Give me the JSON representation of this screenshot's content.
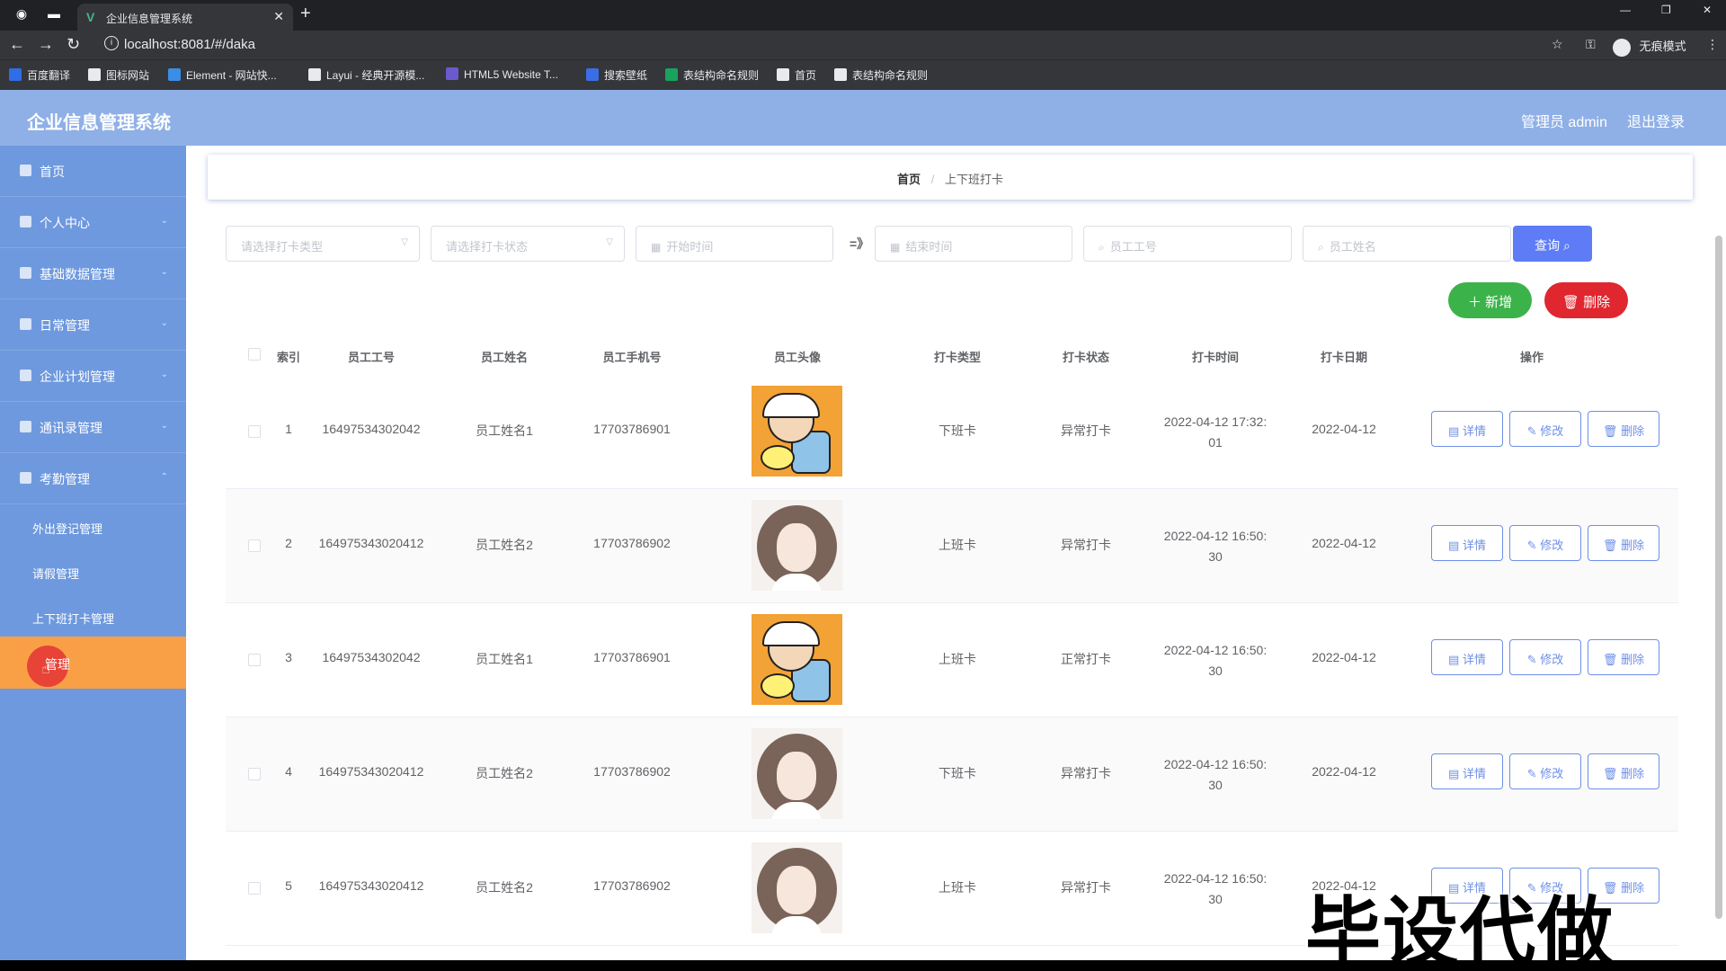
{
  "browser": {
    "tab_title": "企业信息管理系统",
    "url": "localhost:8081/#/daka",
    "incognito_label": "无痕模式",
    "bookmarks": [
      {
        "label": "百度翻译",
        "color": "#2f6ee6"
      },
      {
        "label": "图标网站",
        "color": "#e8eaed"
      },
      {
        "label": "Element - 网站快...",
        "color": "#3b8ee6"
      },
      {
        "label": "Layui - 经典开源模...",
        "color": "#e8eaed"
      },
      {
        "label": "HTML5 Website T...",
        "color": "#6a5acd"
      },
      {
        "label": "搜索壁纸",
        "color": "#3b6ee6"
      },
      {
        "label": "表结构命名规则",
        "color": "#1aa260"
      },
      {
        "label": "首页",
        "color": "#e8eaed"
      },
      {
        "label": "表结构命名规则",
        "color": "#e8eaed"
      }
    ]
  },
  "app": {
    "title": "企业信息管理系统",
    "user": "管理员 admin",
    "logout": "退出登录"
  },
  "sidebar": {
    "items": [
      {
        "label": "首页"
      },
      {
        "label": "个人中心"
      },
      {
        "label": "基础数据管理"
      },
      {
        "label": "日常管理"
      },
      {
        "label": "企业计划管理"
      },
      {
        "label": "通讯录管理"
      },
      {
        "label": "考勤管理"
      }
    ],
    "sub_items": [
      {
        "label": "外出登记管理"
      },
      {
        "label": "请假管理"
      },
      {
        "label": "上下班打卡管理"
      }
    ],
    "active_label": "管理"
  },
  "breadcrumb": {
    "home": "首页",
    "separator": "/",
    "current": "上下班打卡"
  },
  "search": {
    "type_placeholder": "请选择打卡类型",
    "status_placeholder": "请选择打卡状态",
    "start_placeholder": "开始时间",
    "range_separator": "=》",
    "end_placeholder": "结束时间",
    "emp_no_placeholder": "员工工号",
    "emp_name_placeholder": "员工姓名",
    "query_label": "查询"
  },
  "actions": {
    "add_label": "新增",
    "delete_label": "删除"
  },
  "table": {
    "headers": [
      "索引",
      "员工工号",
      "员工姓名",
      "员工手机号",
      "员工头像",
      "打卡类型",
      "打卡状态",
      "打卡时间",
      "打卡日期",
      "操作"
    ],
    "op_labels": {
      "detail": "详情",
      "edit": "修改",
      "delete": "删除"
    },
    "rows": [
      {
        "index": "1",
        "emp_no": "16497534302042",
        "name": "员工姓名1",
        "phone": "17703786901",
        "avatar": "boy",
        "type": "下班卡",
        "status": "异常打卡",
        "time1": "2022-04-12 17:32:",
        "time2": "01",
        "date": "2022-04-12"
      },
      {
        "index": "2",
        "emp_no": "164975343020412",
        "name": "员工姓名2",
        "phone": "17703786902",
        "avatar": "girl",
        "type": "上班卡",
        "status": "异常打卡",
        "time1": "2022-04-12 16:50:",
        "time2": "30",
        "date": "2022-04-12"
      },
      {
        "index": "3",
        "emp_no": "16497534302042",
        "name": "员工姓名1",
        "phone": "17703786901",
        "avatar": "boy",
        "type": "上班卡",
        "status": "正常打卡",
        "time1": "2022-04-12 16:50:",
        "time2": "30",
        "date": "2022-04-12"
      },
      {
        "index": "4",
        "emp_no": "164975343020412",
        "name": "员工姓名2",
        "phone": "17703786902",
        "avatar": "girl",
        "type": "下班卡",
        "status": "异常打卡",
        "time1": "2022-04-12 16:50:",
        "time2": "30",
        "date": "2022-04-12"
      },
      {
        "index": "5",
        "emp_no": "164975343020412",
        "name": "员工姓名2",
        "phone": "17703786902",
        "avatar": "girl",
        "type": "上班卡",
        "status": "异常打卡",
        "time1": "2022-04-12 16:50:",
        "time2": "30",
        "date": "2022-04-12"
      }
    ]
  },
  "watermark": "毕设代做"
}
